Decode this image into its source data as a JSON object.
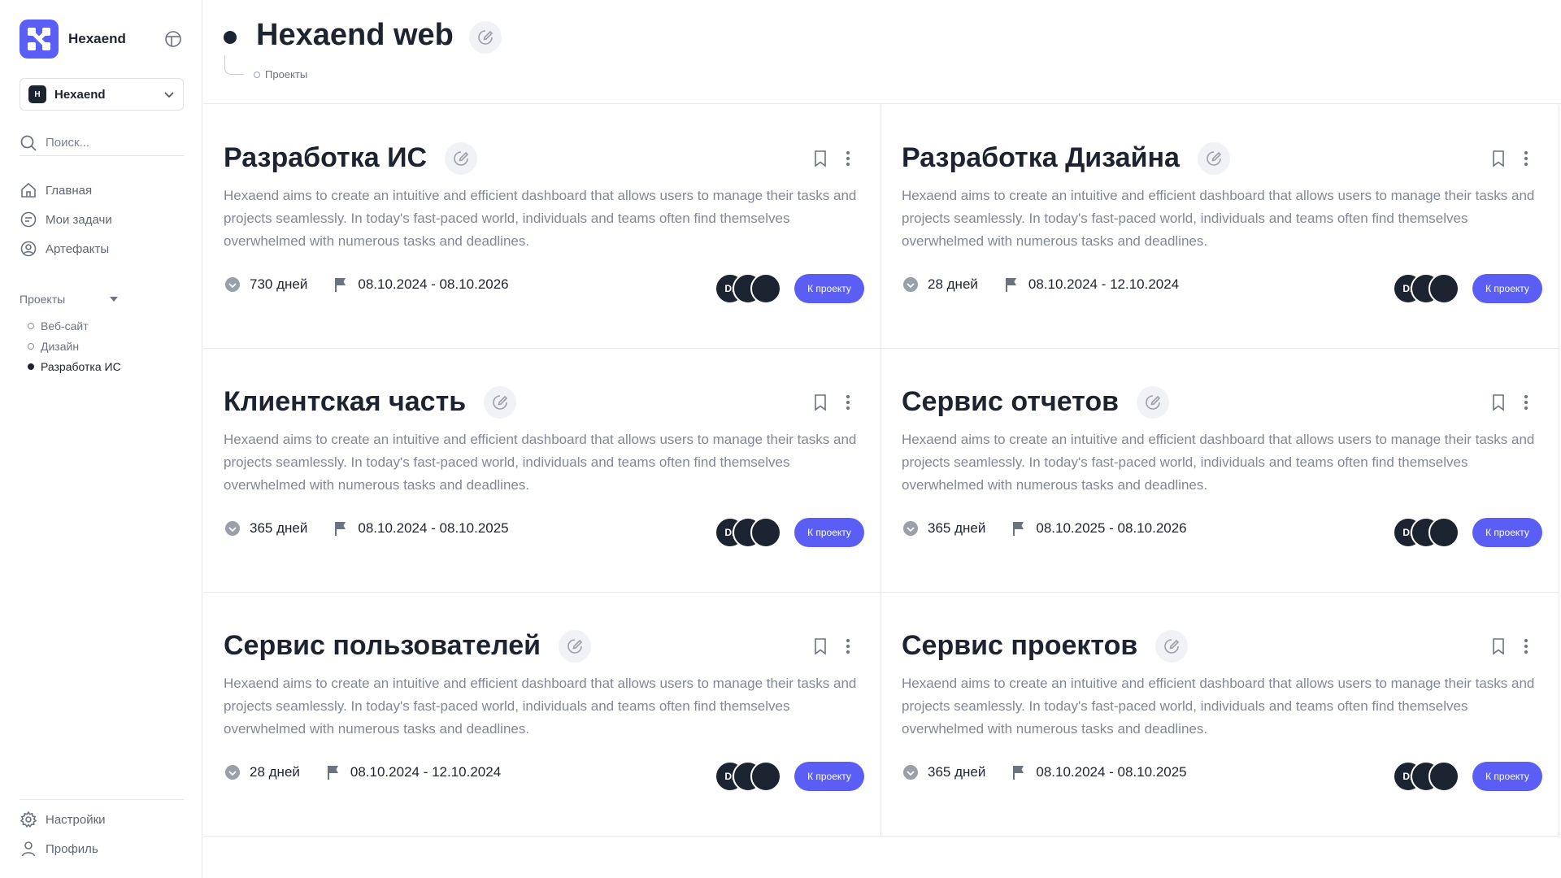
{
  "brand": {
    "name": "Hexaend",
    "accent": "#5b5ef4"
  },
  "org": {
    "badge": "H",
    "name": "Hexaend"
  },
  "search": {
    "placeholder": "Поиск..."
  },
  "nav": {
    "items": [
      {
        "label": "Главная",
        "icon": "home-icon"
      },
      {
        "label": "Мои задачи",
        "icon": "tasks-icon"
      },
      {
        "label": "Артефакты",
        "icon": "artifacts-icon"
      }
    ]
  },
  "projects": {
    "heading": "Проекты",
    "items": [
      {
        "label": "Веб-сайт",
        "active": false
      },
      {
        "label": "Дизайн",
        "active": false
      },
      {
        "label": "Разработка ИС",
        "active": true
      }
    ]
  },
  "bottom_nav": {
    "settings": "Настройки",
    "profile": "Профиль"
  },
  "header": {
    "title": "Hexaend web",
    "breadcrumb": "Проекты"
  },
  "cards": [
    {
      "title": "Разработка ИС",
      "description": "Hexaend aims to create an intuitive and efficient dashboard that allows users to manage their tasks and projects seamlessly. In today's fast-paced world, individuals and teams often find themselves overwhelmed with numerous tasks and deadlines.",
      "duration": "730 дней",
      "dates": "08.10.2024 - 08.10.2026",
      "avatar": "Dr",
      "button": "К проекту"
    },
    {
      "title": "Разработка Дизайна",
      "description": "Hexaend aims to create an intuitive and efficient dashboard that allows users to manage their tasks and projects seamlessly. In today's fast-paced world, individuals and teams often find themselves overwhelmed with numerous tasks and deadlines.",
      "duration": "28 дней",
      "dates": "08.10.2024 - 12.10.2024",
      "avatar": "Dr",
      "button": "К проекту"
    },
    {
      "title": "Клиентская часть",
      "description": "Hexaend aims to create an intuitive and efficient dashboard that allows users to manage their tasks and projects seamlessly. In today's fast-paced world, individuals and teams often find themselves overwhelmed with numerous tasks and deadlines.",
      "duration": "365 дней",
      "dates": "08.10.2024 - 08.10.2025",
      "avatar": "Dr",
      "button": "К проекту"
    },
    {
      "title": "Сервис отчетов",
      "description": "Hexaend aims to create an intuitive and efficient dashboard that allows users to manage their tasks and projects seamlessly. In today's fast-paced world, individuals and teams often find themselves overwhelmed with numerous tasks and deadlines.",
      "duration": "365 дней",
      "dates": "08.10.2025 - 08.10.2026",
      "avatar": "Dr",
      "button": "К проекту"
    },
    {
      "title": "Сервис пользователей",
      "description": "Hexaend aims to create an intuitive and efficient dashboard that allows users to manage their tasks and projects seamlessly. In today's fast-paced world, individuals and teams often find themselves overwhelmed with numerous tasks and deadlines.",
      "duration": "28 дней",
      "dates": "08.10.2024 - 12.10.2024",
      "avatar": "Dr",
      "button": "К проекту"
    },
    {
      "title": "Сервис проектов",
      "description": "Hexaend aims to create an intuitive and efficient dashboard that allows users to manage their tasks and projects seamlessly. In today's fast-paced world, individuals and teams often find themselves overwhelmed with numerous tasks and deadlines.",
      "duration": "365 дней",
      "dates": "08.10.2024 - 08.10.2025",
      "avatar": "Dr",
      "button": "К проекту"
    }
  ]
}
